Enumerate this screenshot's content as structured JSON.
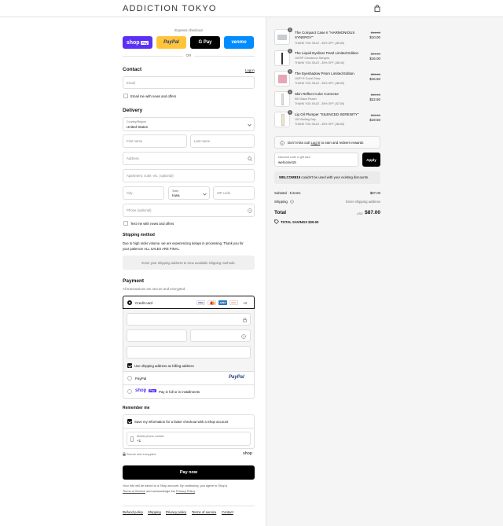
{
  "brand": {
    "logo": "ADDICTION TOKYO"
  },
  "header": {
    "cart_icon": "shopping-bag-icon"
  },
  "express": {
    "title": "Express checkout",
    "shop_pay": "shop",
    "shop_pay_badge": "Pay",
    "paypal": "PayPal",
    "gpay": "G Pay",
    "venmo": "venmo",
    "or": "OR",
    "colors": {
      "shop_pay": "#5a31f4",
      "paypal": "#ffc439",
      "gpay": "#000000",
      "venmo": "#008cff"
    }
  },
  "contact": {
    "heading": "Contact",
    "login": "Log in",
    "email_placeholder": "Email",
    "news_label": "Email me with news and offers"
  },
  "delivery": {
    "heading": "Delivery",
    "country_label": "Country/Region",
    "country_value": "United States",
    "first_name": "First name",
    "last_name": "Last name",
    "address": "Address",
    "apartment": "Apartment, suite, etc. (optional)",
    "city": "City",
    "state_label": "State",
    "state_value": "Iowa",
    "zip": "ZIP code",
    "phone": "Phone (optional)",
    "text_label": "Text me with news and offers"
  },
  "shipping": {
    "heading": "Shipping method",
    "notice_line1": "Due to high order volume, we are experiencing delays in processing. Thank you for",
    "notice_line2": "your patience! ALL SALES ARE FINAL.",
    "placeholder": "Enter your shipping address to view available shipping methods."
  },
  "payment": {
    "heading": "Payment",
    "subtitle": "All transactions are secure and encrypted.",
    "credit_card": "Credit card",
    "cards": [
      "VISA",
      "MC",
      "AMEX",
      "DISC"
    ],
    "more_cards": "+4",
    "billing_label": "Use shipping address as billing address",
    "paypal_option": "PayPal",
    "paypal_logo": "PayPal",
    "shoppay_option": "Pay in full or in installments",
    "shoppay_logo": "shop",
    "shoppay_badge": "Pay"
  },
  "remember": {
    "heading": "Remember me",
    "save_label": "Save my information for a faster checkout with a Shop account",
    "mobile_label": "Mobile phone number",
    "mobile_value": "+1",
    "secure": "Secure and encrypted",
    "shop": "shop"
  },
  "paynow": {
    "label": "Pay now"
  },
  "legal": {
    "line1": "Your info will be saved to a Shop account. By continuing, you agree to Shop's",
    "terms": "Terms of Service",
    "and": "and acknowledge the",
    "privacy": "Privacy Policy",
    "period": "."
  },
  "footer_links": [
    "Refund policy",
    "Shipping",
    "Privacy policy",
    "Terms of service",
    "Contact"
  ],
  "cart": {
    "items": [
      {
        "qty": "1",
        "name": "The Compact Case II \"HARMONIOUS",
        "name2": "SYNERGY\"",
        "variant": "",
        "sale": "THANK YOU SALE - 35% OFF (-$5.60)",
        "compare": "$14.00",
        "price": "$10.00"
      },
      {
        "qty": "1",
        "name": "The Liquid Eyeliner Pearl Limited Edition",
        "name2": "",
        "variant": "100SP Cinnamon Sangria",
        "sale": "THANK YOU SALE - 35% OFF (-$8.40)",
        "compare": "$24.00",
        "price": "$16.00"
      },
      {
        "qty": "1",
        "name": "The Eyeshadow Prism Limited Edition",
        "name2": "",
        "variant": "102P R Coral Glow",
        "sale": "THANK YOU SALE - 35% OFF (-$8.50)",
        "compare": "$25.00",
        "price": "$16.50"
      },
      {
        "qty": "1",
        "name": "Skin Reflect Color Corrector",
        "name2": "",
        "variant": "001 Back Peach",
        "sale": "THANK YOU SALE - 35% OFF (-$7.50)",
        "compare": "$30.00",
        "price": "$22.50"
      },
      {
        "qty": "1",
        "name": "Lip Oil Plumper \"SILENCED SERENITY\"",
        "name2": "",
        "variant": "102 Boiling Day",
        "sale": "THANK YOU SALE - 35% OFF (-$6.65)",
        "compare": "$26.00",
        "price": "$19.50"
      }
    ],
    "rewards_prefix": "Don't miss out!",
    "rewards_link": "Log in",
    "rewards_suffix": "to earn and redeem rewards",
    "discount_label": "Discount code or gift card",
    "discount_value": "welcome15",
    "apply": "Apply",
    "discount_error_code": "WELCOME15",
    "discount_error": "couldn't be used with your existing discounts.",
    "subtotal_label": "Subtotal · 5 items",
    "subtotal": "$87.00",
    "shipping_label": "Shipping",
    "shipping_value": "Enter shipping address",
    "total_label": "Total",
    "currency": "USD",
    "total": "$87.00",
    "savings_label": "TOTAL SAVINGS",
    "savings": "$29.00"
  }
}
